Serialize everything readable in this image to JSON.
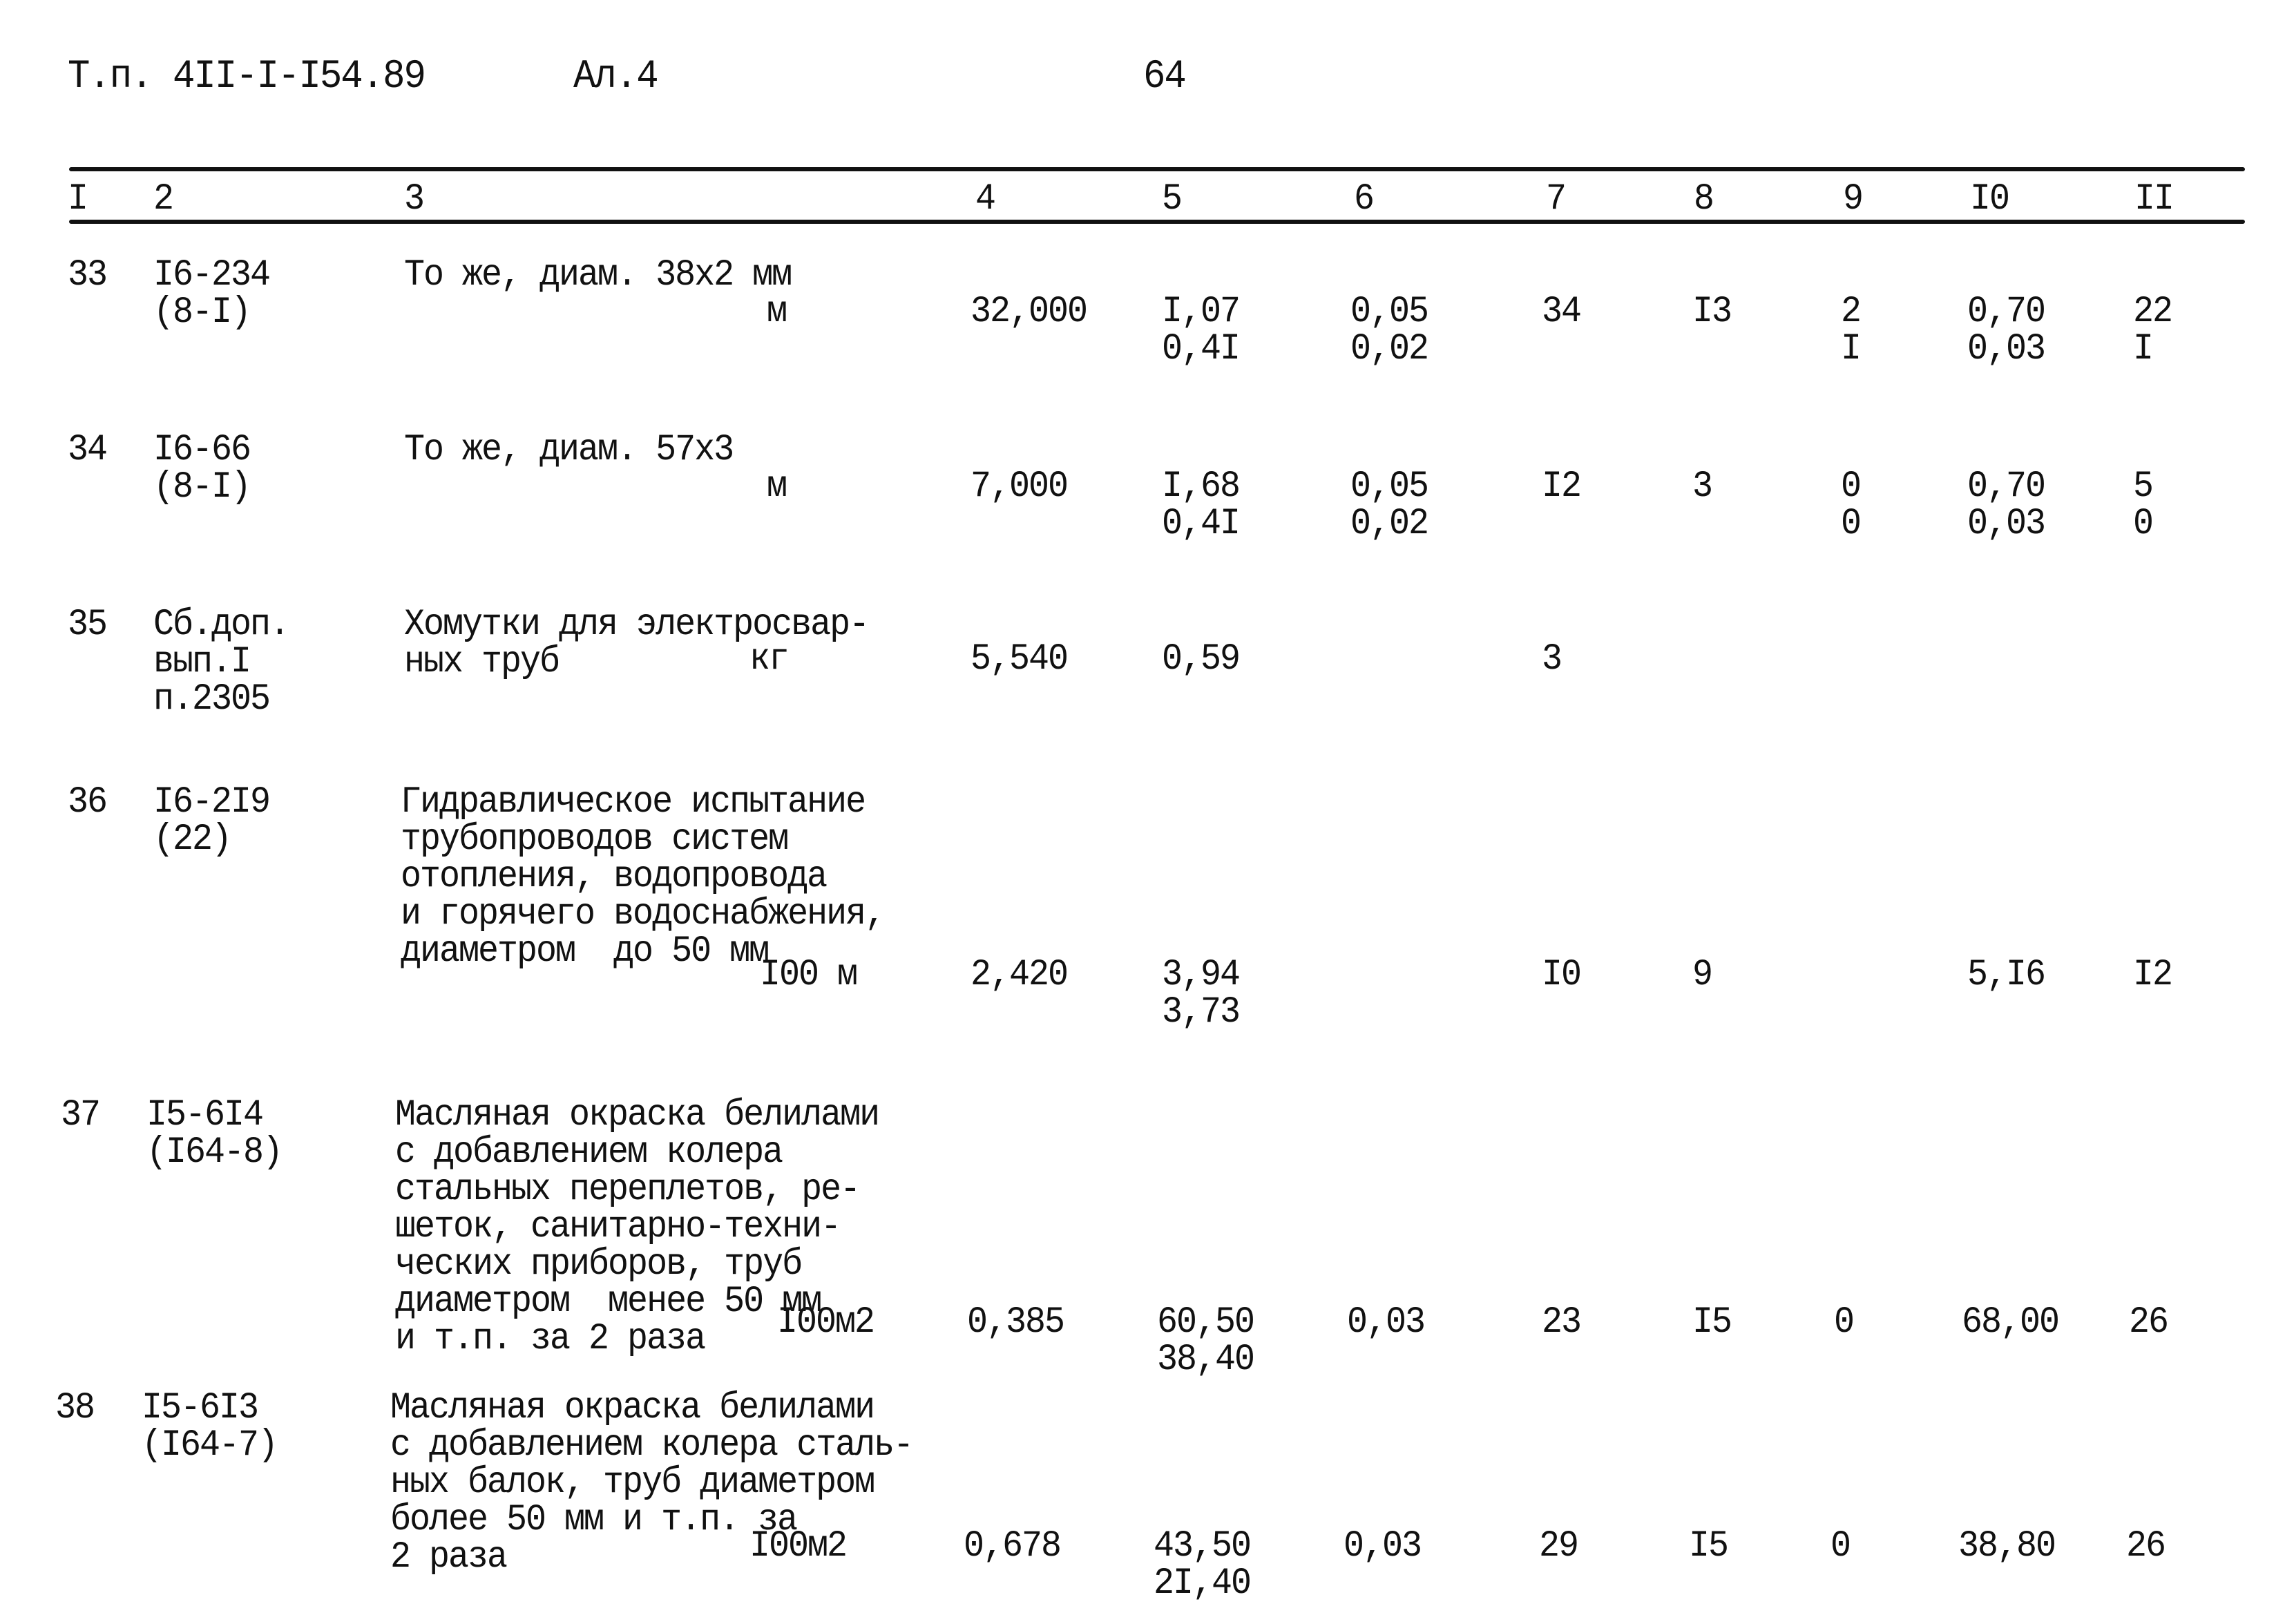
{
  "header": {
    "doc_code": "Т.п. 4II-I-I54.89",
    "album": "Ал.4",
    "page_number": "64"
  },
  "table": {
    "columns": [
      "I",
      "2",
      "3",
      "4",
      "5",
      "6",
      "7",
      "8",
      "9",
      "I0",
      "II"
    ],
    "rows": [
      {
        "num": "33",
        "code": "I6-234\n(8-I)",
        "desc": "То же, диам. 38х2 мм",
        "unit": "м",
        "c4": "32,000",
        "c5": "I,07\n0,4I",
        "c6": "0,05\n0,02",
        "c7": "34",
        "c8": "I3",
        "c9": "2\nI",
        "c10": "0,70\n0,03",
        "c11": "22\nI"
      },
      {
        "num": "34",
        "code": "I6-66\n(8-I)",
        "desc": "То же, диам. 57х3",
        "unit": "м",
        "c4": "7,000",
        "c5": "I,68\n0,4I",
        "c6": "0,05\n0,02",
        "c7": "I2",
        "c8": "3",
        "c9": "0\n0",
        "c10": "0,70\n0,03",
        "c11": "5\n0"
      },
      {
        "num": "35",
        "code": "Сб.доп.\nвып.I\nп.2305",
        "desc": "Хомутки для электросвар-\nных труб",
        "unit": "кг",
        "c4": "5,540",
        "c5": "0,59",
        "c6": "",
        "c7": "3",
        "c8": "",
        "c9": "",
        "c10": "",
        "c11": ""
      },
      {
        "num": "36",
        "code": "I6-2I9\n(22)",
        "desc": "Гидравлическое испытание\nтрубопроводов систем\nотопления, водопровода\nи горячего водоснабжения,\nдиаметром  до 50 мм",
        "unit": "I00 м",
        "c4": "2,420",
        "c5": "3,94\n3,73",
        "c6": "",
        "c7": "I0",
        "c8": "9",
        "c9": "",
        "c10": "5,I6",
        "c11": "I2"
      },
      {
        "num": "37",
        "code": "I5-6I4\n(I64-8)",
        "desc": "Масляная окраска белилами\nс добавлением колера\nстальных переплетов, ре-\nшеток, санитарно-техни-\nческих приборов, труб\nдиаметром  менее 50 мм\nи т.п. за 2 раза",
        "unit": "I00м2",
        "c4": "0,385",
        "c5": "60,50\n38,40",
        "c6": "0,03",
        "c7": "23",
        "c8": "I5",
        "c9": "0",
        "c10": "68,00",
        "c11": "26"
      },
      {
        "num": "38",
        "code": "I5-6I3\n(I64-7)",
        "desc": "Масляная окраска белилами\nс добавлением колера сталь-\nных балок, труб диаметром\nболее 50 мм и т.п. за\n2 раза",
        "unit": "I00м2",
        "c4": "0,678",
        "c5": "43,50\n2I,40",
        "c6": "0,03",
        "c7": "29",
        "c8": "I5",
        "c9": "0",
        "c10": "38,80",
        "c11": "26"
      }
    ]
  }
}
